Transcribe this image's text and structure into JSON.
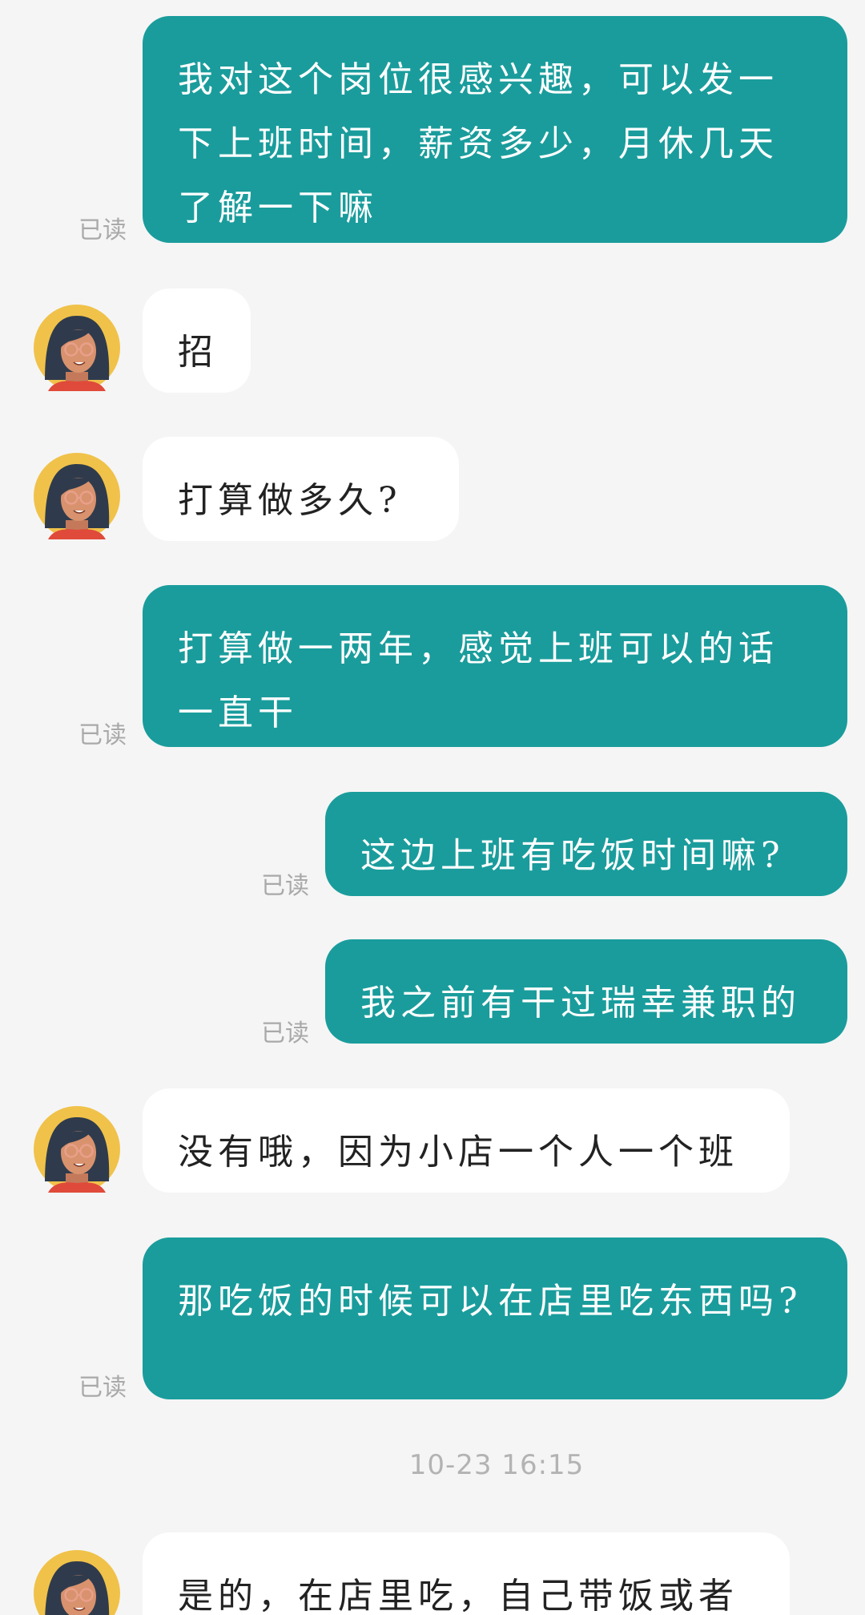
{
  "read_label": "已读",
  "messages": [
    {
      "id": 1,
      "from": "me",
      "text": "我对这个岗位很感兴趣，可以发一下上班时间，薪资多少，月休几天了解一下嘛"
    },
    {
      "id": 2,
      "from": "them",
      "text": "招"
    },
    {
      "id": 3,
      "from": "them",
      "text": "打算做多久?"
    },
    {
      "id": 4,
      "from": "me",
      "text": "打算做一两年，感觉上班可以的话一直干"
    },
    {
      "id": 5,
      "from": "me",
      "text": "这边上班有吃饭时间嘛?"
    },
    {
      "id": 6,
      "from": "me",
      "text": "我之前有干过瑞幸兼职的"
    },
    {
      "id": 7,
      "from": "them",
      "text": "没有哦，因为小店一个人一个班"
    },
    {
      "id": 8,
      "from": "me",
      "text": "那吃饭的时候可以在店里吃东西吗?"
    },
    {
      "id": 9,
      "from": "them",
      "text": "是的，在店里吃，自己带饭或者"
    }
  ],
  "timestamp": "10-23  16:15",
  "colors": {
    "sent_bubble": "#1a9c9c",
    "received_bubble": "#ffffff",
    "background": "#f5f5f5",
    "read_text": "#a9a9a9",
    "avatar_bg": "#f0c24a"
  }
}
